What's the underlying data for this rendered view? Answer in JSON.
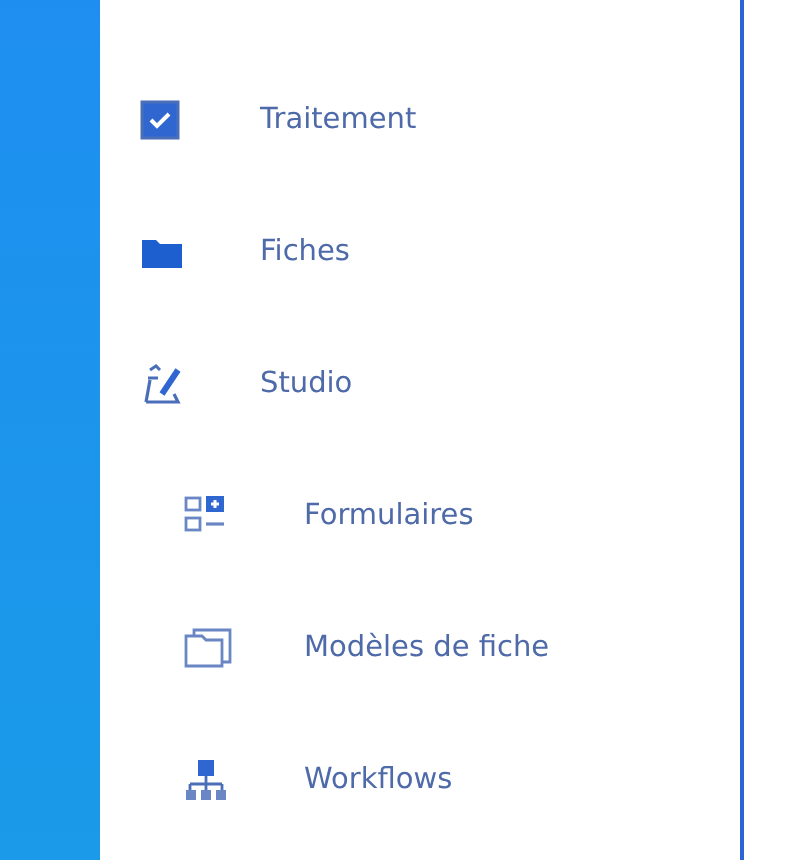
{
  "sidebar": {
    "items": [
      {
        "label": "Traitement"
      },
      {
        "label": "Fiches"
      },
      {
        "label": "Studio",
        "children": [
          {
            "label": "Formulaires"
          },
          {
            "label": "Modèles de fiche"
          },
          {
            "label": "Workflows"
          }
        ]
      }
    ]
  }
}
